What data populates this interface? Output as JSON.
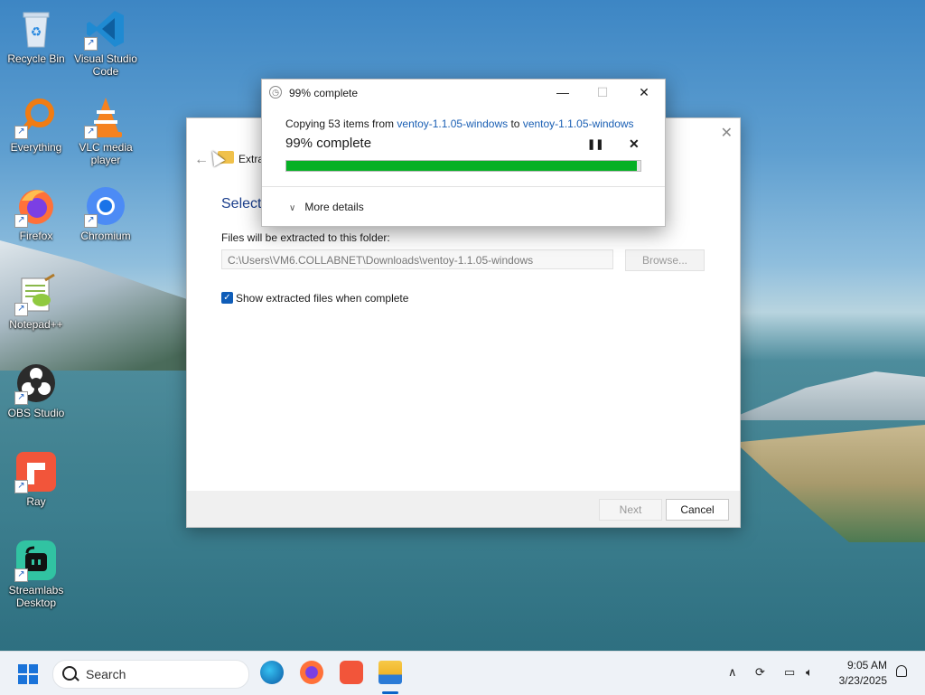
{
  "desktop": {
    "icons": [
      {
        "label": "Recycle Bin",
        "icon": "recycle-bin-icon"
      },
      {
        "label": "Visual Studio Code",
        "icon": "vscode-icon"
      },
      {
        "label": "Everything",
        "icon": "everything-search-icon"
      },
      {
        "label": "VLC media player",
        "icon": "vlc-icon"
      },
      {
        "label": "Firefox",
        "icon": "firefox-icon"
      },
      {
        "label": "Chromium",
        "icon": "chromium-icon"
      },
      {
        "label": "Notepad++",
        "icon": "notepadpp-icon"
      },
      {
        "label": "OBS Studio",
        "icon": "obs-icon"
      },
      {
        "label": "Ray",
        "icon": "ray-icon"
      },
      {
        "label": "Streamlabs Desktop",
        "icon": "streamlabs-icon"
      }
    ]
  },
  "extract_dialog": {
    "title": "Extra",
    "heading": "Select",
    "folder_label": "Files will be extracted to this folder:",
    "path_value": "C:\\Users\\VM6.COLLABNET\\Downloads\\ventoy-1.1.05-windows",
    "browse_label": "Browse...",
    "show_files_label": "Show extracted files when complete",
    "show_files_checked": true,
    "next_label": "Next",
    "cancel_label": "Cancel"
  },
  "progress_dialog": {
    "title": "99% complete",
    "copy_prefix": "Copying 53 items from ",
    "source": "ventoy-1.1.05-windows",
    "copy_to": " to ",
    "destination": "ventoy-1.1.05-windows",
    "percent_text": "99% complete",
    "progress": 0.99,
    "more_details_label": "More details",
    "accent_color": "#06b025"
  },
  "taskbar": {
    "search_placeholder": "Search",
    "pinned": [
      "edge-icon",
      "firefox-icon",
      "ray-icon",
      "file-explorer-icon"
    ],
    "time": "9:05 AM",
    "date": "3/23/2025"
  }
}
